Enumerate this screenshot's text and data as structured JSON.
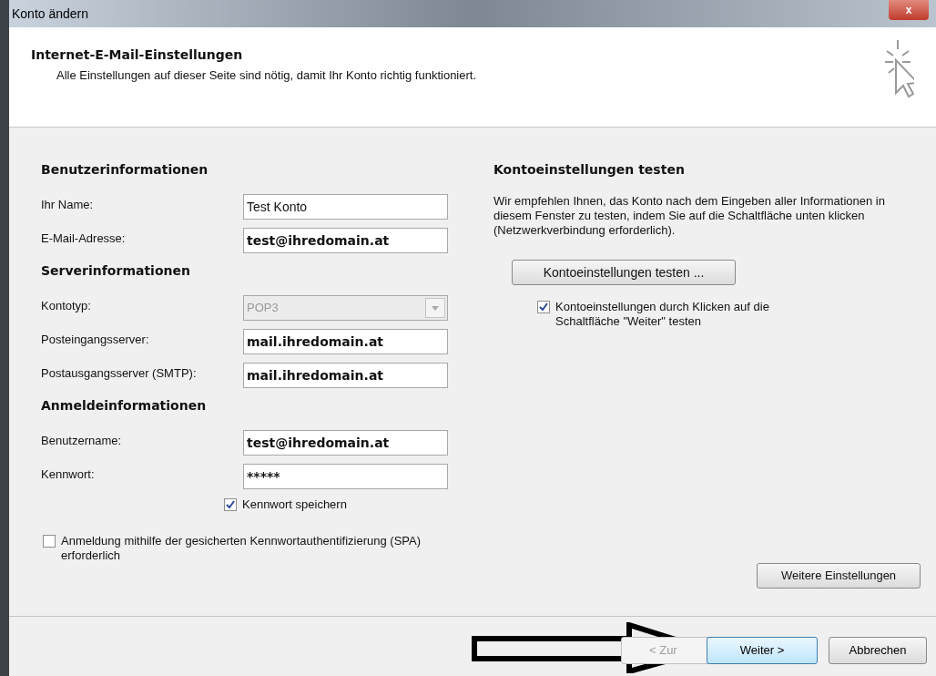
{
  "window": {
    "title": "Konto ändern",
    "close": "x"
  },
  "header": {
    "title": "Internet-E-Mail-Einstellungen",
    "subtitle": "Alle Einstellungen auf dieser Seite sind nötig, damit Ihr Konto richtig funktioniert."
  },
  "left": [
    {
      "kind": "heading",
      "text": "Benutzerinformationen"
    },
    {
      "kind": "field",
      "label": "Ihr Name:",
      "value": "Test Konto",
      "bold": false
    },
    {
      "kind": "field",
      "label": "E-Mail-Adresse:",
      "value": "test@ihredomain.at",
      "bold": true
    },
    {
      "kind": "heading",
      "text": "Serverinformationen"
    },
    {
      "kind": "select",
      "label": "Kontotyp:",
      "value": "POP3",
      "disabled": true
    },
    {
      "kind": "field",
      "label": "Posteingangsserver:",
      "value": "mail.ihredomain.at",
      "bold": true
    },
    {
      "kind": "field",
      "label": "Postausgangsserver (SMTP):",
      "value": "mail.ihredomain.at",
      "bold": true
    },
    {
      "kind": "heading",
      "text": "Anmeldeinformationen"
    },
    {
      "kind": "field",
      "label": "Benutzername:",
      "value": "test@ihredomain.at",
      "bold": true
    },
    {
      "kind": "field",
      "label": "Kennwort:",
      "value": "*****",
      "bold": true
    },
    {
      "kind": "checkbox",
      "label": "Kennwort speichern",
      "checked": true,
      "indent": true
    },
    {
      "kind": "checkbox",
      "label": "Anmeldung mithilfe der gesicherten Kennwortauthentifizierung (SPA) erforderlich",
      "checked": false,
      "indent": false
    }
  ],
  "right": {
    "heading": "Kontoeinstellungen testen",
    "text": "Wir empfehlen Ihnen, das Konto nach dem Eingeben aller Informationen in diesem Fenster zu testen, indem Sie auf die Schaltfläche unten klicken (Netzwerkverbindung erforderlich).",
    "button": "Kontoeinstellungen testen ...",
    "checkbox": {
      "label": "Kontoeinstellungen durch Klicken auf die Schaltfläche \"Weiter\" testen",
      "checked": true
    },
    "more_button": "Weitere Einstellungen"
  },
  "footer": {
    "buttons": [
      {
        "label": "< Zur",
        "disabled": true,
        "default": false
      },
      {
        "label": "Weiter >",
        "disabled": false,
        "default": true
      },
      {
        "label": "Abbrechen",
        "disabled": false,
        "default": false
      }
    ]
  }
}
